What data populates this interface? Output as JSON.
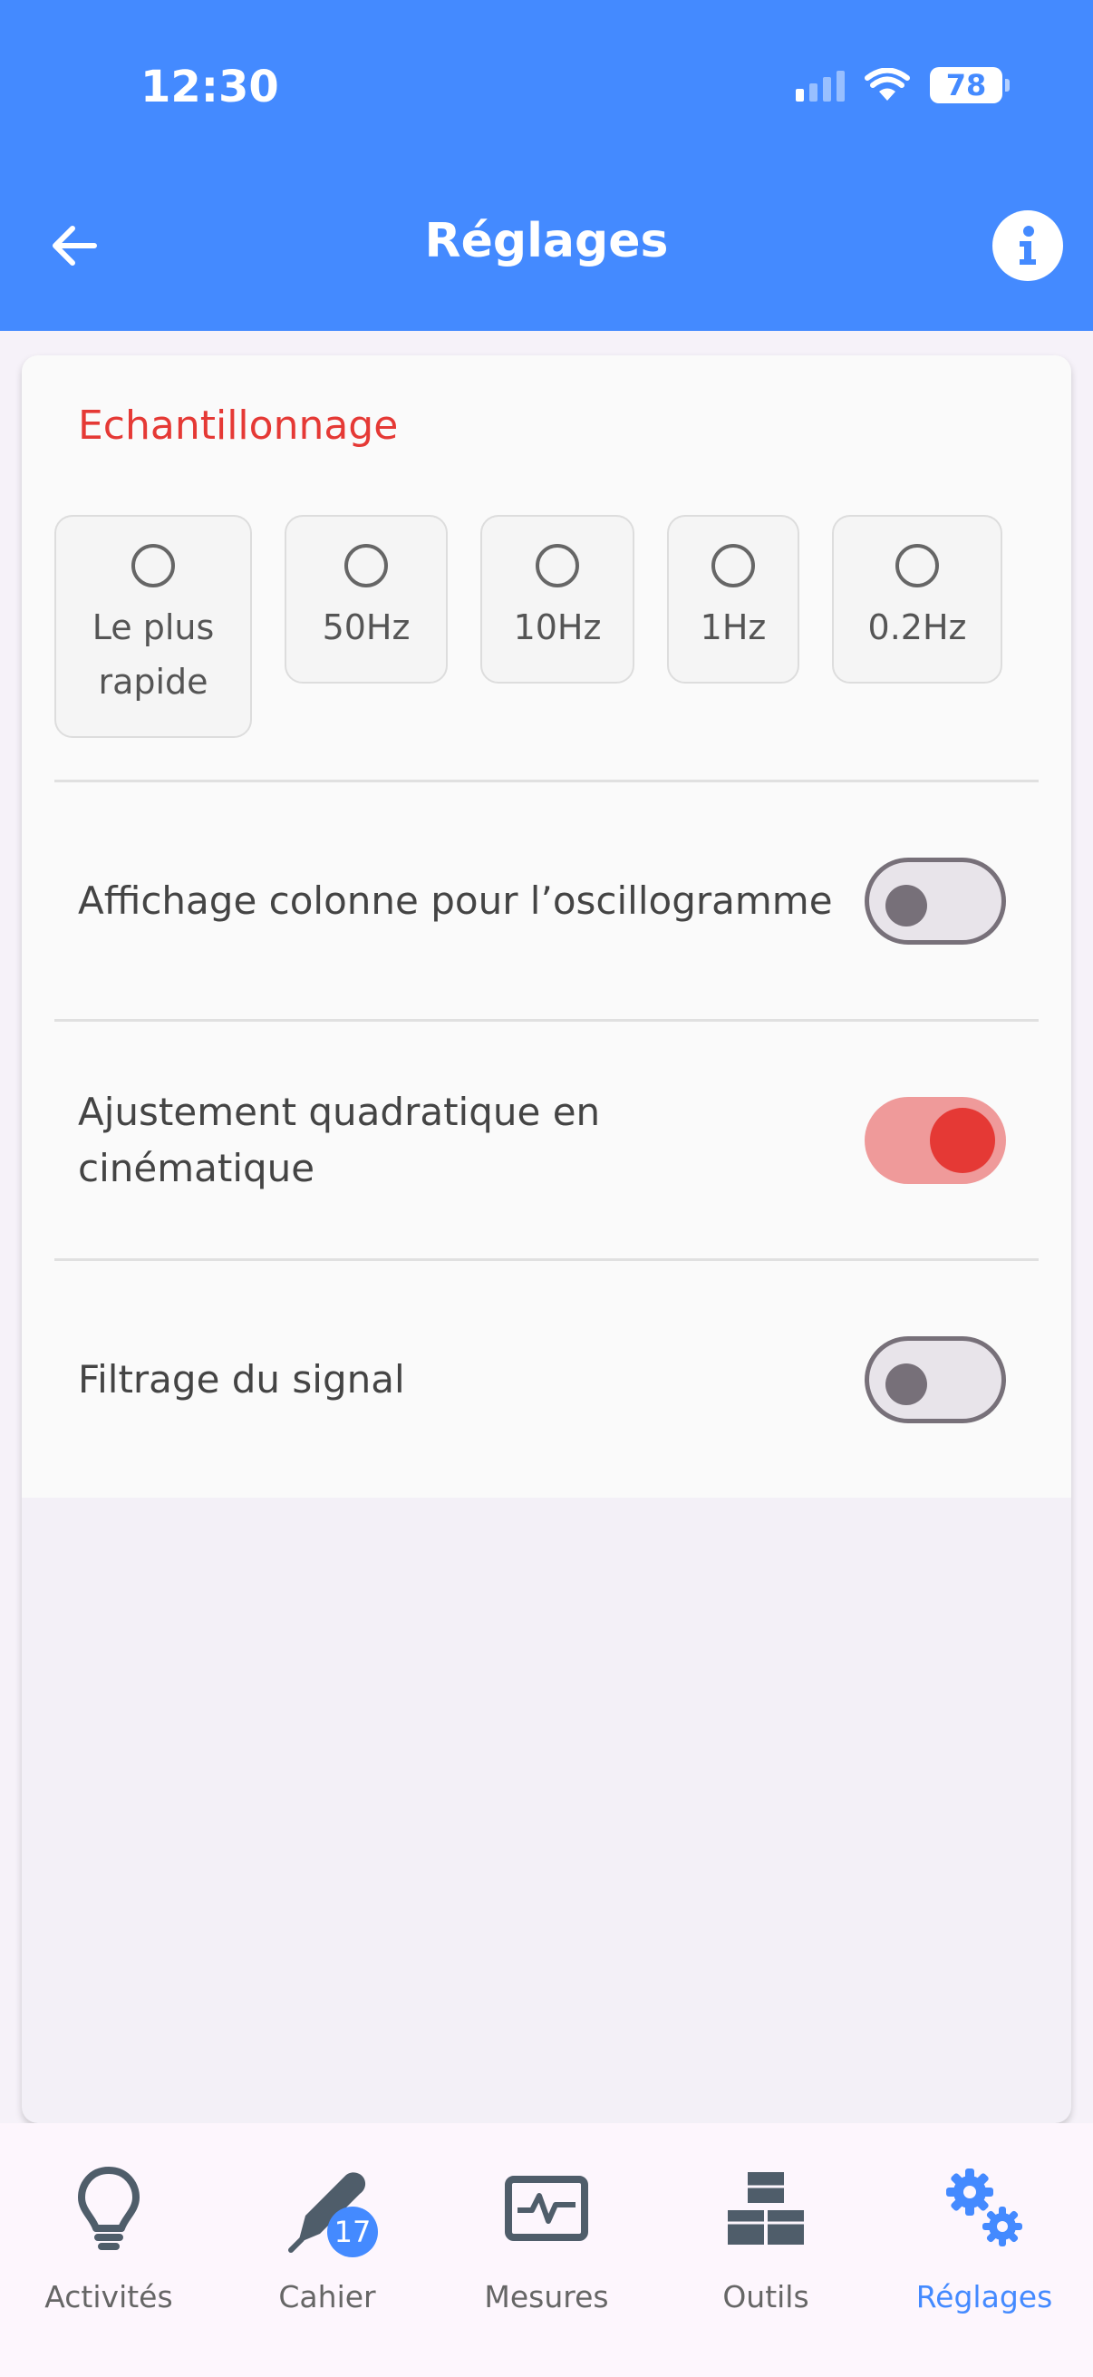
{
  "status_bar": {
    "time": "12:30",
    "battery": "78"
  },
  "header": {
    "title": "Réglages"
  },
  "sampling": {
    "title": "Echantillonnage",
    "options": [
      {
        "label_line1": "Le plus",
        "label_line2": "rapide"
      },
      {
        "label_line1": "50Hz"
      },
      {
        "label_line1": "10Hz"
      },
      {
        "label_line1": "1Hz"
      },
      {
        "label_line1": "0.2Hz"
      }
    ]
  },
  "settings": [
    {
      "label": "Affichage colonne pour l’oscillogramme",
      "enabled": false
    },
    {
      "label_line1": "Ajustement quadratique en",
      "label_line2": "cinématique",
      "enabled": true
    },
    {
      "label": "Filtrage du signal",
      "enabled": false
    }
  ],
  "bottom_nav": {
    "items": [
      {
        "label": "Activités",
        "icon": "lightbulb-icon"
      },
      {
        "label": "Cahier",
        "icon": "pen-icon",
        "badge": "17"
      },
      {
        "label": "Mesures",
        "icon": "pulse-monitor-icon"
      },
      {
        "label": "Outils",
        "icon": "cubes-icon"
      },
      {
        "label": "Réglages",
        "icon": "gears-icon",
        "active": true
      }
    ]
  },
  "colors": {
    "primary": "#448aff",
    "accent": "#e53935"
  }
}
